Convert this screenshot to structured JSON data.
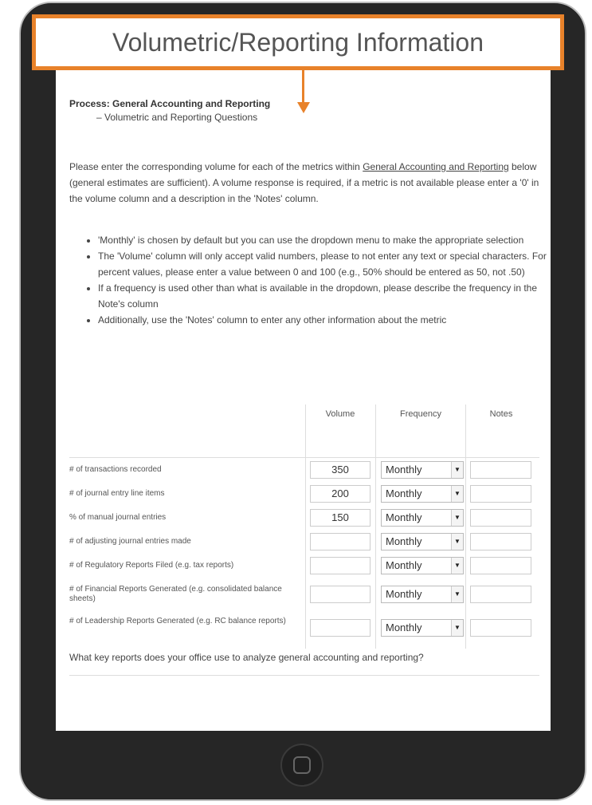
{
  "banner": {
    "title": "Volumetric/Reporting Information"
  },
  "process": {
    "title": "Process: General Accounting and Reporting",
    "subtitle": "– Volumetric and Reporting Questions"
  },
  "intro": {
    "text_before": "Please enter the corresponding volume for each of the metrics within ",
    "link": "General Accounting and Reporting",
    "text_after": " below (general estimates are sufficient). A volume response is required, if a metric is not available please enter a '0' in the volume column and a description in the 'Notes' column."
  },
  "bullets": [
    "'Monthly' is chosen by default but you can use the dropdown menu to make the appropriate selection",
    "The 'Volume' column will only accept valid numbers, please to not enter any text or special characters. For percent values, please enter a value between 0 and 100 (e.g., 50% should be entered as 50, not .50)",
    "If a frequency is used other than what is available in the dropdown, please describe the frequency in the Note's column",
    "Additionally, use the 'Notes' column to enter any other information about the metric"
  ],
  "table": {
    "headers": {
      "volume": "Volume",
      "frequency": "Frequency",
      "notes": "Notes"
    },
    "rows": [
      {
        "label": "# of transactions recorded",
        "volume": "350",
        "frequency": "Monthly",
        "notes": ""
      },
      {
        "label": "# of journal entry line items",
        "volume": "200",
        "frequency": "Monthly",
        "notes": ""
      },
      {
        "label": "% of manual journal entries",
        "volume": "150",
        "frequency": "Monthly",
        "notes": ""
      },
      {
        "label": "# of adjusting journal entries made",
        "volume": "",
        "frequency": "Monthly",
        "notes": ""
      },
      {
        "label": "# of Regulatory Reports Filed (e.g. tax reports)",
        "volume": "",
        "frequency": "Monthly",
        "notes": ""
      },
      {
        "label": "# of Financial Reports Generated (e.g. consolidated balance sheets)",
        "volume": "",
        "frequency": "Monthly",
        "notes": ""
      },
      {
        "label": "# of Leadership Reports Generated (e.g. RC balance reports)",
        "volume": "",
        "frequency": "Monthly",
        "notes": ""
      }
    ]
  },
  "question": "What key reports does your office use to analyze general accounting and reporting?",
  "icons": {
    "dropdown": "dropdown-arrow-icon",
    "home": "home-button-icon"
  },
  "colors": {
    "accent": "#e8822a",
    "device": "#262626"
  }
}
